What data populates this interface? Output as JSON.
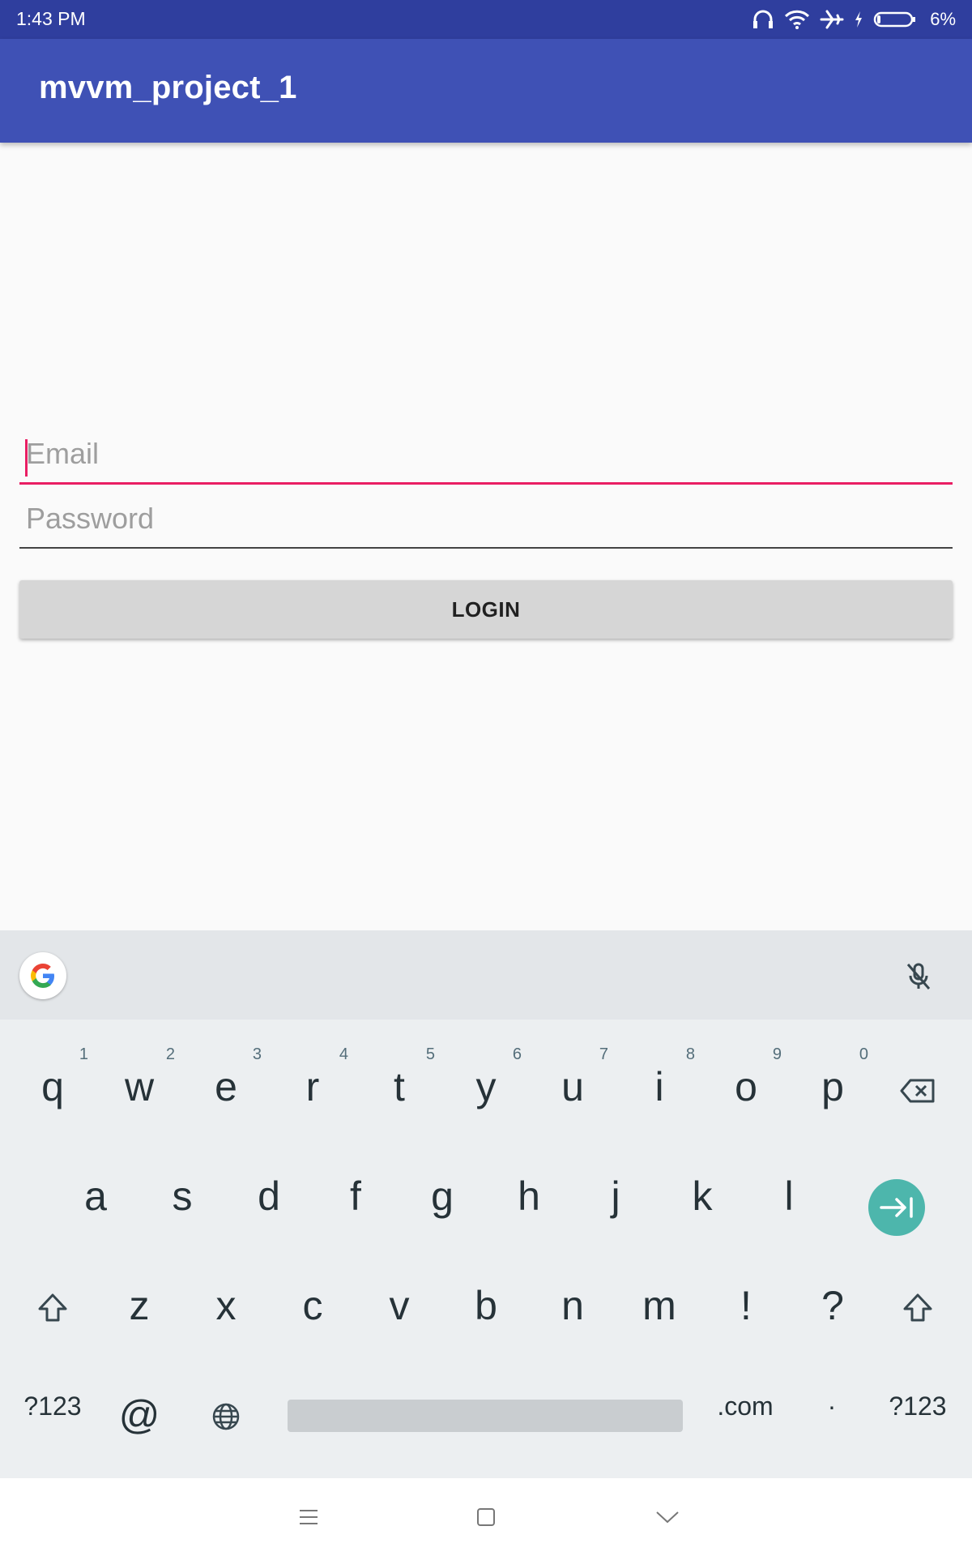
{
  "status_bar": {
    "time": "1:43 PM",
    "battery": "6%",
    "icons": [
      "headphones-icon",
      "wifi-icon",
      "airplane-icon",
      "charging-icon",
      "battery-icon"
    ]
  },
  "app_bar": {
    "title": "mvvm_project_1"
  },
  "form": {
    "email_placeholder": "Email",
    "email_value": "",
    "password_placeholder": "Password",
    "password_value": "",
    "login_label": "LOGIN"
  },
  "colors": {
    "status_bar": "#2f3e9e",
    "app_bar": "#3f51b5",
    "accent": "#e91e63",
    "keyboard_enter": "#4db6ac"
  },
  "keyboard": {
    "row1": [
      {
        "key": "q",
        "hint": "1"
      },
      {
        "key": "w",
        "hint": "2"
      },
      {
        "key": "e",
        "hint": "3"
      },
      {
        "key": "r",
        "hint": "4"
      },
      {
        "key": "t",
        "hint": "5"
      },
      {
        "key": "y",
        "hint": "6"
      },
      {
        "key": "u",
        "hint": "7"
      },
      {
        "key": "i",
        "hint": "8"
      },
      {
        "key": "o",
        "hint": "9"
      },
      {
        "key": "p",
        "hint": "0"
      }
    ],
    "row2": [
      "a",
      "s",
      "d",
      "f",
      "g",
      "h",
      "j",
      "k",
      "l"
    ],
    "row3": [
      "z",
      "x",
      "c",
      "v",
      "b",
      "n",
      "m",
      "!",
      "?"
    ],
    "row4": {
      "symbols_left": "?123",
      "at": "@",
      "dotcom": ".com",
      "dot": "·",
      "symbols_right": "?123"
    },
    "icons": [
      "google-icon",
      "mic-off-icon",
      "backspace-icon",
      "shift-icon",
      "globe-icon",
      "enter-icon"
    ]
  },
  "nav_bar": {
    "icons": [
      "menu-icon",
      "home-icon",
      "back-icon"
    ]
  }
}
